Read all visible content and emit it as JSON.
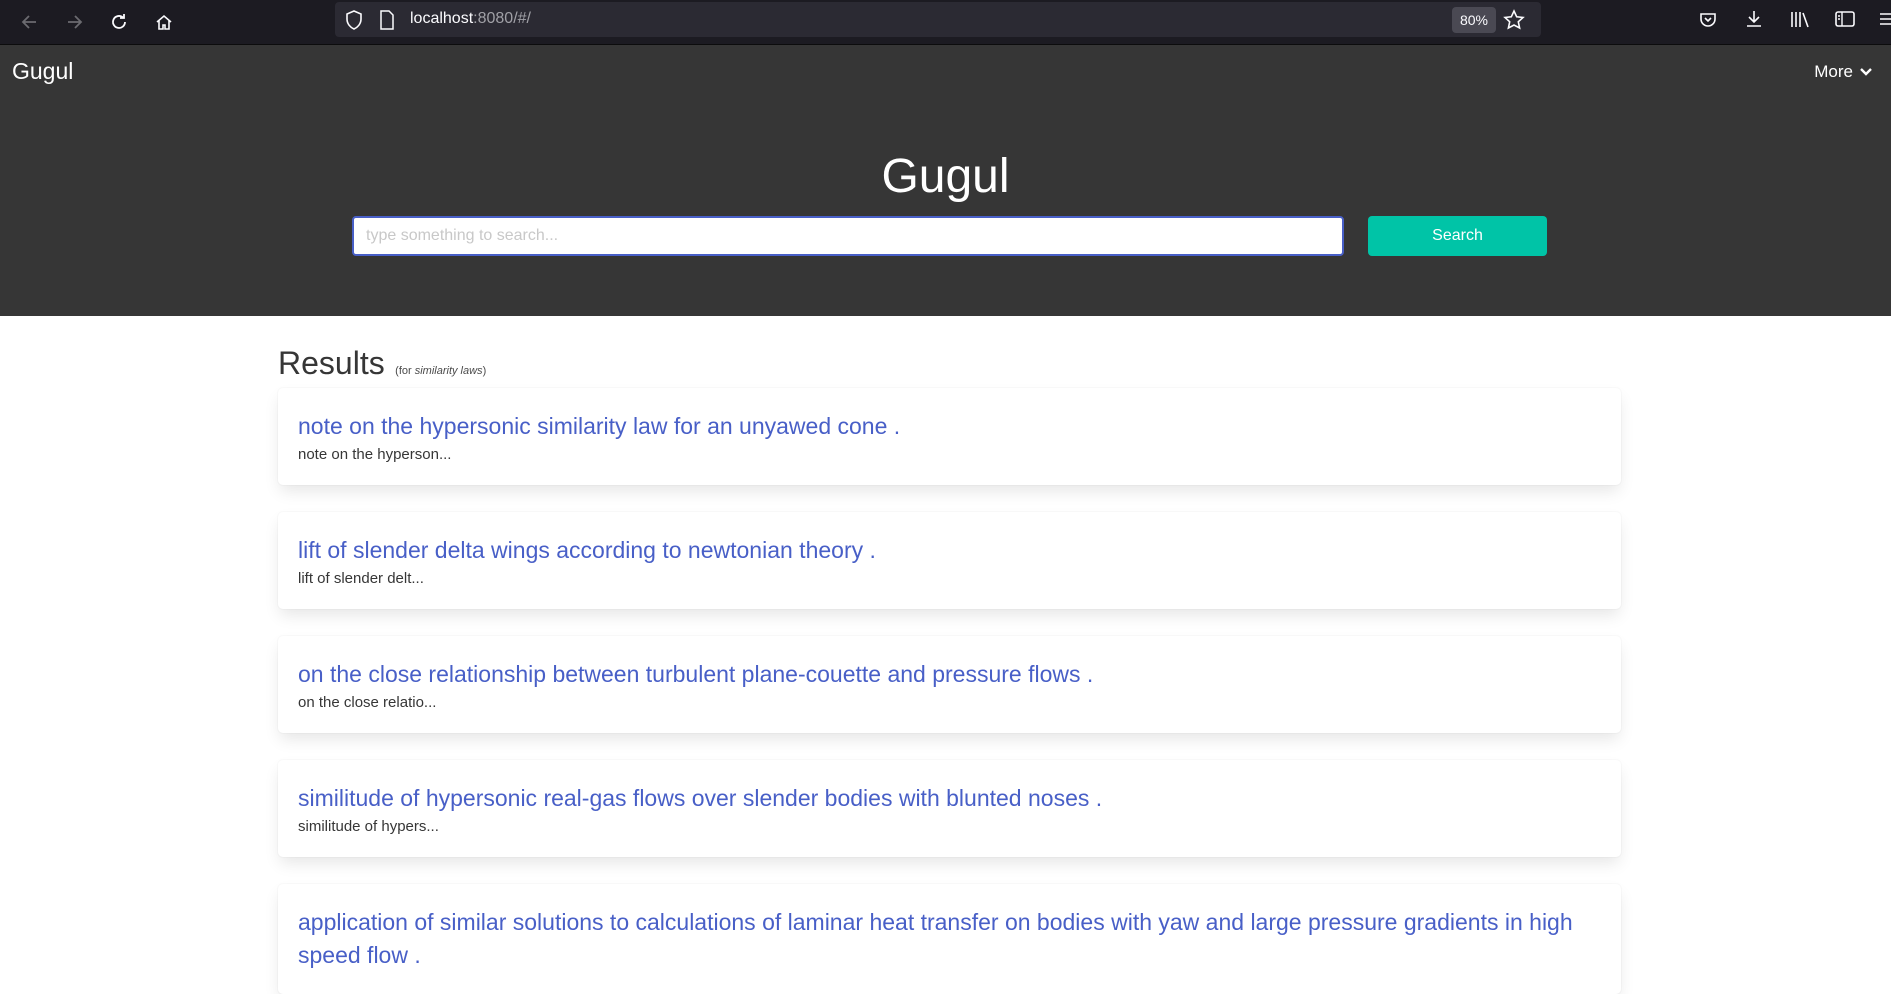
{
  "browser": {
    "url_host": "localhost",
    "url_rest": ":8080/#/",
    "zoom": "80%"
  },
  "navbar": {
    "brand": "Gugul",
    "more_label": "More"
  },
  "hero": {
    "title": "Gugul",
    "search_placeholder": "type something to search...",
    "search_value": "",
    "search_button": "Search"
  },
  "results": {
    "heading": "Results",
    "for_prefix": "(for ",
    "query": "similarity laws",
    "for_suffix": ")",
    "items": [
      {
        "title": "note on the hypersonic similarity law for an unyawed cone .",
        "snippet": "note on the hyperson..."
      },
      {
        "title": "lift of slender delta wings according to newtonian theory .",
        "snippet": "lift of slender delt..."
      },
      {
        "title": "on the close relationship between turbulent plane-couette and pressure flows .",
        "snippet": "on the close relatio..."
      },
      {
        "title": "similitude of hypersonic real-gas flows over slender bodies with blunted noses .",
        "snippet": "similitude of hypers..."
      },
      {
        "title": "application of similar solutions to calculations of laminar heat transfer on bodies with yaw and large pressure gradients in high speed flow .",
        "snippet": ""
      }
    ]
  },
  "colors": {
    "hero_bg": "#363636",
    "link": "#485fc7",
    "search_button": "#00c4a7"
  }
}
